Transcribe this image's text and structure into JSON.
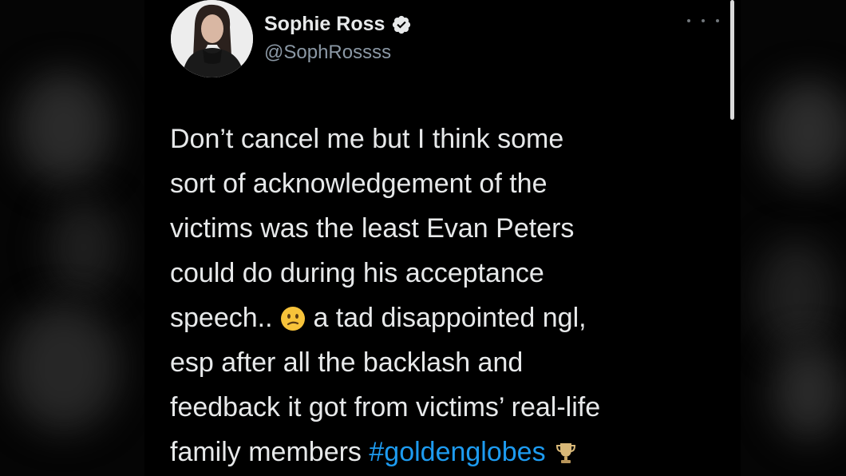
{
  "tweet": {
    "author": {
      "display_name": "Sophie Ross",
      "handle": "@SophRossss",
      "verified": true,
      "avatar_icon": "avatar-photo"
    },
    "menu_icon": "more-icon",
    "body": {
      "line1": "Don’t cancel me but I think some",
      "line2": "sort of acknowledgement of the",
      "line3": "victims was the least Evan Peters",
      "line4": "could do during his acceptance",
      "line5_before_emoji": "speech..",
      "line5_after_emoji": "a tad disappointed ngl,",
      "line6": "esp after all the backlash and",
      "line7": "feedback it got from victims’ real-life",
      "line8_text": "family members",
      "hashtag": "#goldenglobes",
      "emoji_1": "confused-face-icon",
      "emoji_2": "trophy-icon"
    }
  },
  "colors": {
    "background": "#000000",
    "text": "#e7e9ea",
    "secondary": "#8b98a5",
    "link": "#1d9bf0",
    "verified": "#e7e9ea"
  }
}
